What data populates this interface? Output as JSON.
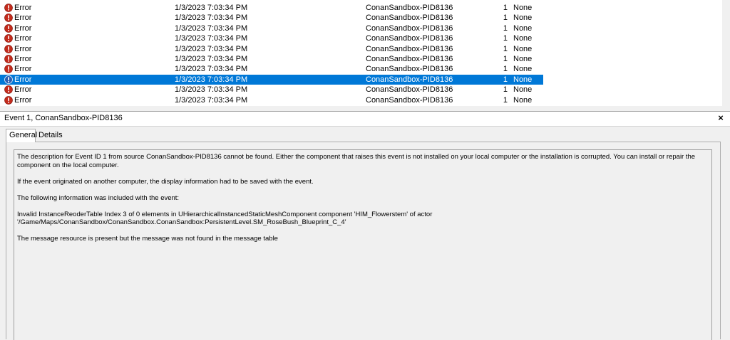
{
  "events": [
    {
      "level": "Error",
      "date": "1/3/2023 7:03:34 PM",
      "source": "ConanSandbox-PID8136",
      "event_id": "1",
      "task": "None",
      "selected": false
    },
    {
      "level": "Error",
      "date": "1/3/2023 7:03:34 PM",
      "source": "ConanSandbox-PID8136",
      "event_id": "1",
      "task": "None",
      "selected": false
    },
    {
      "level": "Error",
      "date": "1/3/2023 7:03:34 PM",
      "source": "ConanSandbox-PID8136",
      "event_id": "1",
      "task": "None",
      "selected": false
    },
    {
      "level": "Error",
      "date": "1/3/2023 7:03:34 PM",
      "source": "ConanSandbox-PID8136",
      "event_id": "1",
      "task": "None",
      "selected": false
    },
    {
      "level": "Error",
      "date": "1/3/2023 7:03:34 PM",
      "source": "ConanSandbox-PID8136",
      "event_id": "1",
      "task": "None",
      "selected": false
    },
    {
      "level": "Error",
      "date": "1/3/2023 7:03:34 PM",
      "source": "ConanSandbox-PID8136",
      "event_id": "1",
      "task": "None",
      "selected": false
    },
    {
      "level": "Error",
      "date": "1/3/2023 7:03:34 PM",
      "source": "ConanSandbox-PID8136",
      "event_id": "1",
      "task": "None",
      "selected": false
    },
    {
      "level": "Error",
      "date": "1/3/2023 7:03:34 PM",
      "source": "ConanSandbox-PID8136",
      "event_id": "1",
      "task": "None",
      "selected": true
    },
    {
      "level": "Error",
      "date": "1/3/2023 7:03:34 PM",
      "source": "ConanSandbox-PID8136",
      "event_id": "1",
      "task": "None",
      "selected": false
    },
    {
      "level": "Error",
      "date": "1/3/2023 7:03:34 PM",
      "source": "ConanSandbox-PID8136",
      "event_id": "1",
      "task": "None",
      "selected": false
    }
  ],
  "detail": {
    "title": "Event 1, ConanSandbox-PID8136",
    "close_symbol": "×",
    "tabs": {
      "general": "General",
      "details": "Details"
    },
    "description": "The description for Event ID 1 from source ConanSandbox-PID8136 cannot be found. Either the component that raises this event is not installed on your local computer or the installation is corrupted. You can install or repair the component on the local computer.\n\nIf the event originated on another computer, the display information had to be saved with the event.\n\nThe following information was included with the event:\n\nInvalid InstanceReoderTable Index 3 of 0 elements in UHierarchicalInstancedStaticMeshComponent component 'HIM_Flowerstem' of actor '/Game/Maps/ConanSandbox/ConanSandbox.ConanSandbox:PersistentLevel.SM_RoseBush_Blueprint_C_4'\n\nThe message resource is present but the message was not found in the message table"
  },
  "colors": {
    "error_icon": "#c42b1c",
    "selection": "#0078d7"
  },
  "icons": {
    "row_level": "error-icon",
    "close": "close-icon"
  }
}
